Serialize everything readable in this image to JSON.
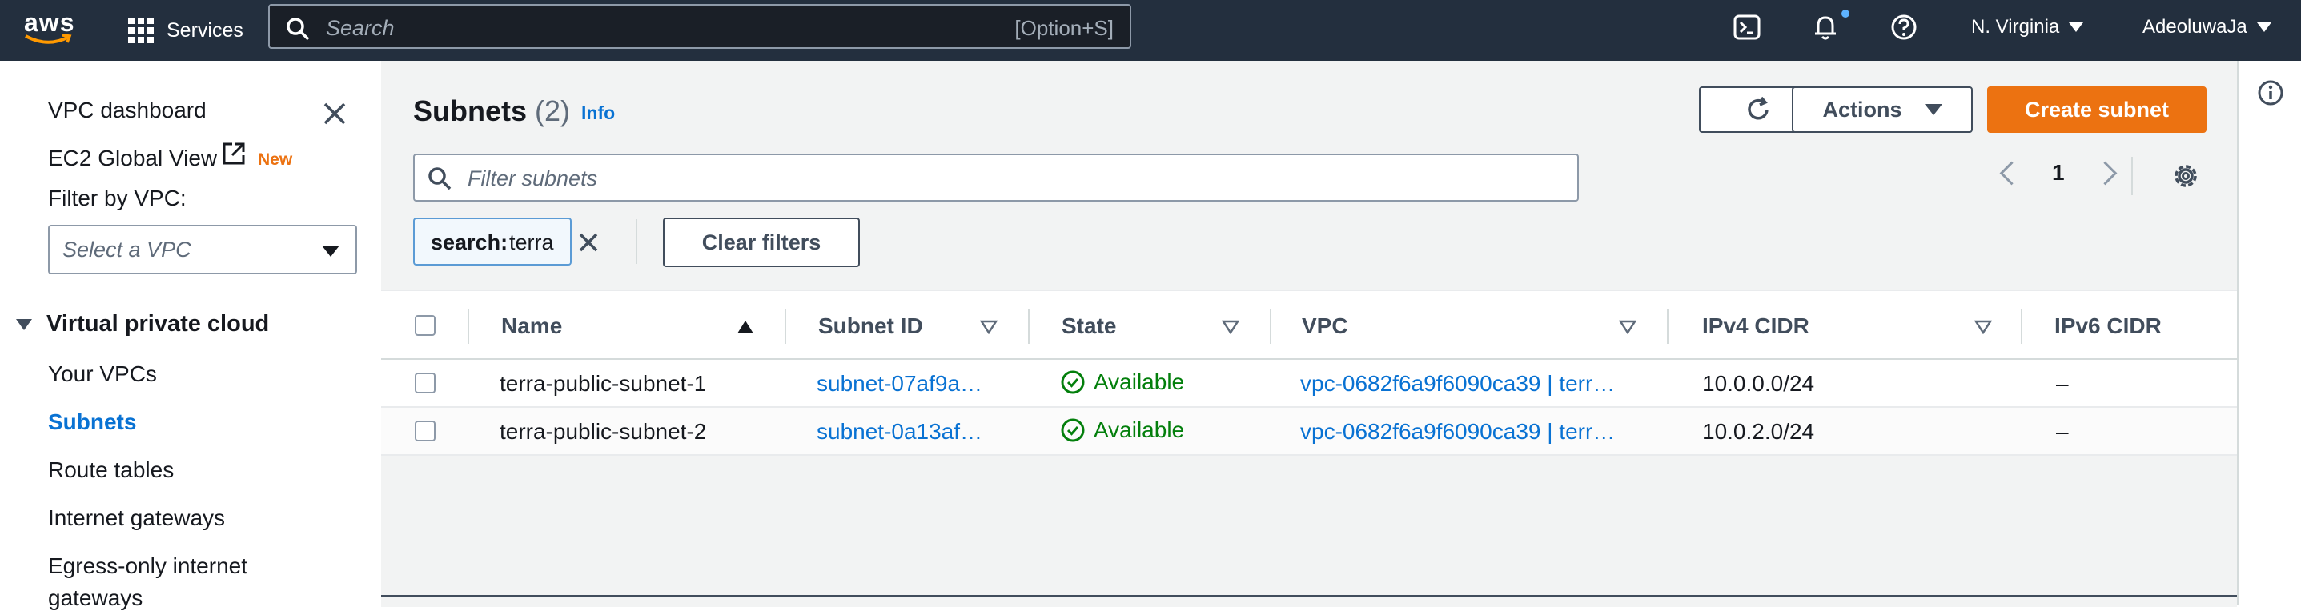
{
  "topnav": {
    "logo_text": "aws",
    "services_label": "Services",
    "search_placeholder": "Search",
    "search_shortcut": "[Option+S]",
    "region": "N. Virginia",
    "user": "AdeoluwaJa"
  },
  "sidebar": {
    "dashboard": "VPC dashboard",
    "ec2_global_view": "EC2 Global View",
    "new_badge": "New",
    "filter_label": "Filter by VPC:",
    "vpc_select_placeholder": "Select a VPC",
    "section_title": "Virtual private cloud",
    "items": [
      {
        "label": "Your VPCs",
        "active": false
      },
      {
        "label": "Subnets",
        "active": true
      },
      {
        "label": "Route tables",
        "active": false
      },
      {
        "label": "Internet gateways",
        "active": false
      },
      {
        "label": "Egress-only internet",
        "active": false
      },
      {
        "label": "gateways",
        "active": false
      }
    ]
  },
  "main": {
    "title": "Subnets",
    "count": "(2)",
    "info": "Info",
    "actions_label": "Actions",
    "create_label": "Create subnet",
    "filter_placeholder": "Filter subnets",
    "page": "1",
    "token_key": "search:",
    "token_value": "terra",
    "clear_filters": "Clear filters",
    "columns": [
      "Name",
      "Subnet ID",
      "State",
      "VPC",
      "IPv4 CIDR",
      "IPv6 CIDR"
    ],
    "rows": [
      {
        "name": "terra-public-subnet-1",
        "subnet_id": "subnet-07af9a…",
        "state": "Available",
        "vpc": "vpc-0682f6a9f6090ca39 | terr…",
        "ipv4": "10.0.0.0/24",
        "ipv6": "–"
      },
      {
        "name": "terra-public-subnet-2",
        "subnet_id": "subnet-0a13af…",
        "state": "Available",
        "vpc": "vpc-0682f6a9f6090ca39 | terr…",
        "ipv4": "10.0.2.0/24",
        "ipv6": "–"
      }
    ]
  },
  "colors": {
    "nav_bg": "#232f3e",
    "accent_orange": "#ec7211",
    "link_blue": "#0972d3",
    "success_green": "#037f0c"
  }
}
